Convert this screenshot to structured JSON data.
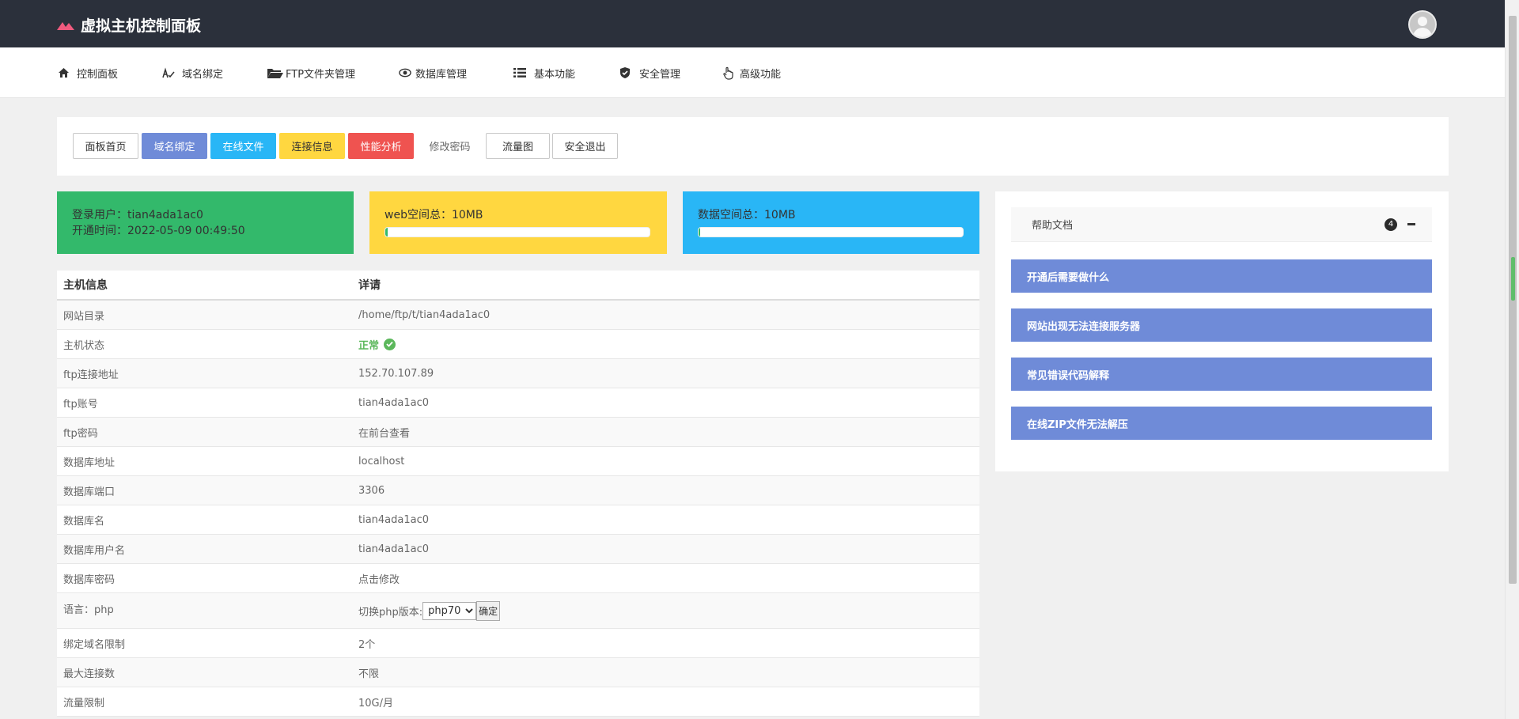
{
  "app": {
    "title": "虚拟主机控制面板",
    "accent": "#ef5a7e"
  },
  "navbar": {
    "items": [
      {
        "icon": "home-icon",
        "label": "控制面板"
      },
      {
        "icon": "signature-icon",
        "label": "域名绑定"
      },
      {
        "icon": "folder-open-icon",
        "label": "FTP文件夹管理"
      },
      {
        "icon": "eye-icon",
        "label": "数据库管理"
      },
      {
        "icon": "list-icon",
        "label": "基本功能"
      },
      {
        "icon": "shield-icon",
        "label": "安全管理"
      },
      {
        "icon": "pointer-hand-icon",
        "label": "高级功能"
      }
    ]
  },
  "toolbar": {
    "buttons": [
      {
        "label": "面板首页",
        "style": "default"
      },
      {
        "label": "域名绑定",
        "style": "primary",
        "color": "#6f8bd8"
      },
      {
        "label": "在线文件",
        "style": "info",
        "color": "#29b6f6"
      },
      {
        "label": "连接信息",
        "style": "warning",
        "color": "#ffd740"
      },
      {
        "label": "性能分析",
        "style": "danger",
        "color": "#ef5350"
      },
      {
        "label": "修改密码",
        "style": "link"
      },
      {
        "label": "流量图",
        "style": "default"
      },
      {
        "label": "安全退出",
        "style": "default"
      }
    ]
  },
  "stats": {
    "user": {
      "label_user": "登录用户：tian4ada1ac0",
      "label_time": "开通时间：2022-05-09 00:49:50",
      "color": "#33b96b"
    },
    "web": {
      "label": "web空间总：10MB",
      "progress": 0.01,
      "color": "#ffd740"
    },
    "db": {
      "label": "数据空间总：10MB",
      "progress": 0.005,
      "color": "#29b6f6"
    }
  },
  "info_table": {
    "header": {
      "left": "主机信息",
      "right": "详请"
    },
    "rows": [
      {
        "label": "网站目录",
        "value": "/home/ftp/t/tian4ada1ac0"
      },
      {
        "label": "主机状态",
        "value": "正常"
      },
      {
        "label": "ftp连接地址",
        "value": "152.70.107.89"
      },
      {
        "label": "ftp账号",
        "value": "tian4ada1ac0"
      },
      {
        "label": "ftp密码",
        "value": "在前台查看"
      },
      {
        "label": "数据库地址",
        "value": "localhost"
      },
      {
        "label": "数据库端口",
        "value": "3306"
      },
      {
        "label": "数据库名",
        "value": "tian4ada1ac0"
      },
      {
        "label": "数据库用户名",
        "value": "tian4ada1ac0"
      },
      {
        "label": "数据库密码",
        "value": "点击修改"
      },
      {
        "label": "语言：php",
        "value": "切换php版本:"
      },
      {
        "label": "绑定域名限制",
        "value": "2个"
      },
      {
        "label": "最大连接数",
        "value": "不限"
      },
      {
        "label": "流量限制",
        "value": "10G/月"
      }
    ],
    "php_select": {
      "selected": "php70",
      "confirm_label": "确定"
    },
    "status_color": "#5cb85c"
  },
  "help": {
    "title": "帮助文档",
    "count": "4",
    "items": [
      "开通后需要做什么",
      "网站出现无法连接服务器",
      "常见错误代码解释",
      "在线ZIP文件无法解压"
    ]
  }
}
